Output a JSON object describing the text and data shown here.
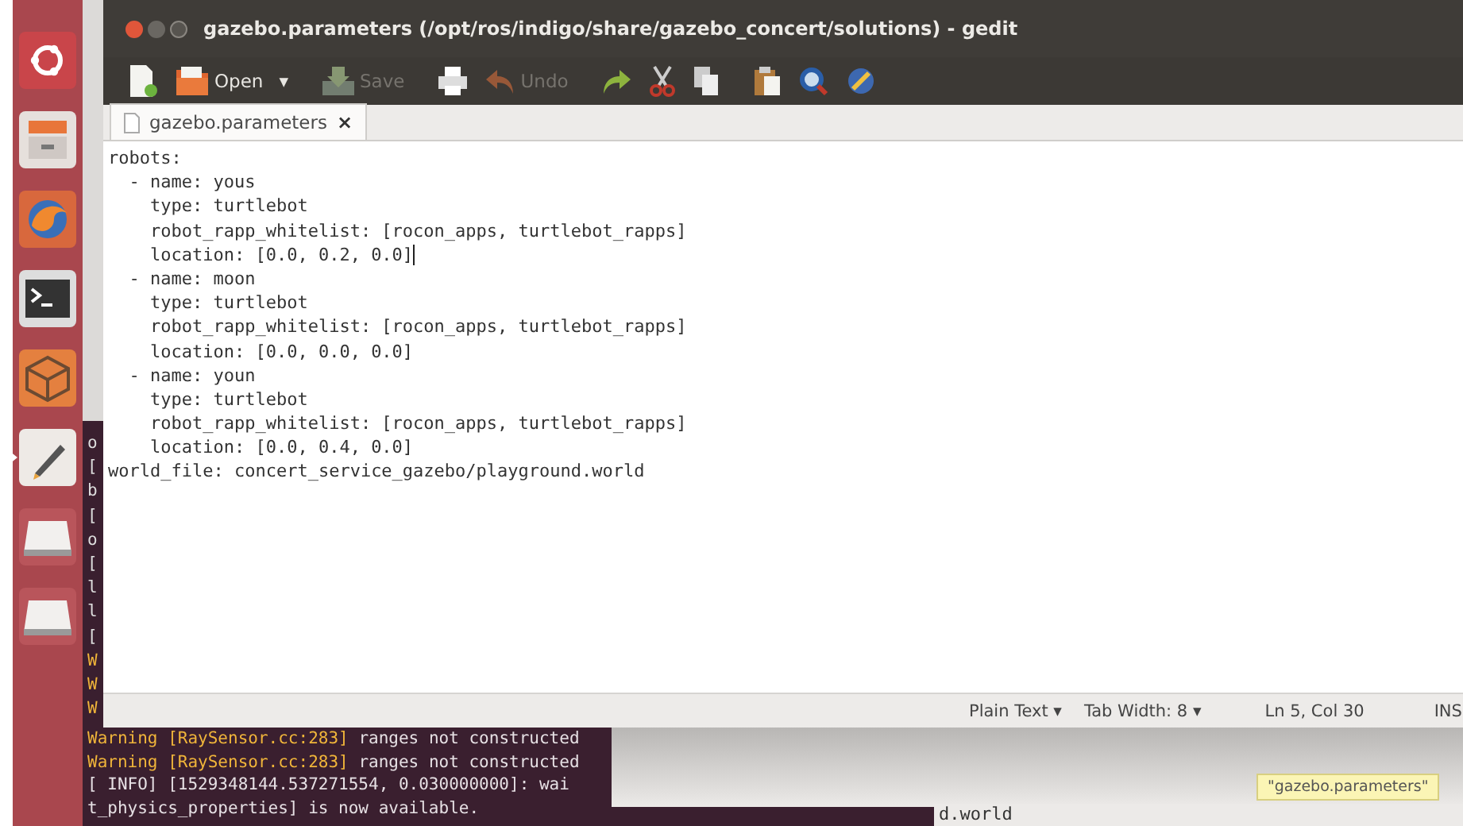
{
  "launcher": {
    "items": [
      {
        "kind": "ubuntu"
      },
      {
        "kind": "files"
      },
      {
        "kind": "browser"
      },
      {
        "kind": "terminal"
      },
      {
        "kind": "box"
      },
      {
        "kind": "editor",
        "running": true
      },
      {
        "kind": "drive"
      },
      {
        "kind": "drive"
      }
    ]
  },
  "window": {
    "title": "gazebo.parameters (/opt/ros/indigo/share/gazebo_concert/solutions) - gedit"
  },
  "toolbar": [
    {
      "kind": "new",
      "disabled": false
    },
    {
      "kind": "open",
      "label": "Open",
      "disabled": false
    },
    {
      "kind": "dropdown",
      "label": "▾",
      "disabled": false
    },
    {
      "kind": "save",
      "label": "Save",
      "disabled": true
    },
    {
      "kind": "print",
      "disabled": false
    },
    {
      "kind": "undo",
      "label": "Undo",
      "disabled": true
    },
    {
      "kind": "redo",
      "disabled": false
    },
    {
      "kind": "cut",
      "disabled": false
    },
    {
      "kind": "copy",
      "disabled": false
    },
    {
      "kind": "paste",
      "disabled": false
    },
    {
      "kind": "find",
      "disabled": false
    },
    {
      "kind": "replace",
      "disabled": false
    }
  ],
  "tabs": [
    {
      "label": "gazebo.parameters",
      "close": "×",
      "selected": true
    }
  ],
  "editor": {
    "lines": [
      {
        "text": "robots:",
        "cursor": false
      },
      {
        "text": "  - name: yous",
        "cursor": false
      },
      {
        "text": "    type: turtlebot",
        "cursor": false
      },
      {
        "text": "    robot_rapp_whitelist: [rocon_apps, turtlebot_rapps]",
        "cursor": false
      },
      {
        "text": "    location: [0.0, 0.2, 0.0]",
        "cursor": true
      },
      {
        "text": "  - name: moon",
        "cursor": false
      },
      {
        "text": "    type: turtlebot",
        "cursor": false
      },
      {
        "text": "    robot_rapp_whitelist: [rocon_apps, turtlebot_rapps]",
        "cursor": false
      },
      {
        "text": "    location: [0.0, 0.0, 0.0]",
        "cursor": false
      },
      {
        "text": "  - name: youn",
        "cursor": false
      },
      {
        "text": "    type: turtlebot",
        "cursor": false
      },
      {
        "text": "    robot_rapp_whitelist: [rocon_apps, turtlebot_rapps]",
        "cursor": false
      },
      {
        "text": "    location: [0.0, 0.4, 0.0]",
        "cursor": false
      },
      {
        "text": "world_file: concert_service_gazebo/playground.world",
        "cursor": false
      }
    ]
  },
  "status_bar": {
    "language": "Plain Text ▾",
    "tab_width": "Tab Width: 8 ▾",
    "position": "Ln 5, Col 30",
    "mode": "INS"
  },
  "terminal": {
    "edge_chars": [
      "o",
      "[",
      "b",
      "[",
      "o",
      "[",
      "l",
      "l",
      "[",
      "W",
      "W",
      "W"
    ],
    "lines": [
      [
        {
          "kind": "warning",
          "text": "Warning [RaySensor.cc:283]"
        },
        {
          "kind": "plain",
          "text": " ranges not constructed"
        }
      ],
      [
        {
          "kind": "warning",
          "text": "Warning [RaySensor.cc:283]"
        },
        {
          "kind": "plain",
          "text": " ranges not constructed"
        }
      ],
      [
        {
          "kind": "plain",
          "text": "[ INFO] [1529348144.537271554, 0.030000000]: wai"
        }
      ],
      [
        {
          "kind": "plain",
          "text": "t_physics_properties] is now available."
        }
      ]
    ]
  },
  "other_window": {
    "text": "d.world"
  },
  "notification": {
    "text": "\"gazebo.parameters\""
  }
}
